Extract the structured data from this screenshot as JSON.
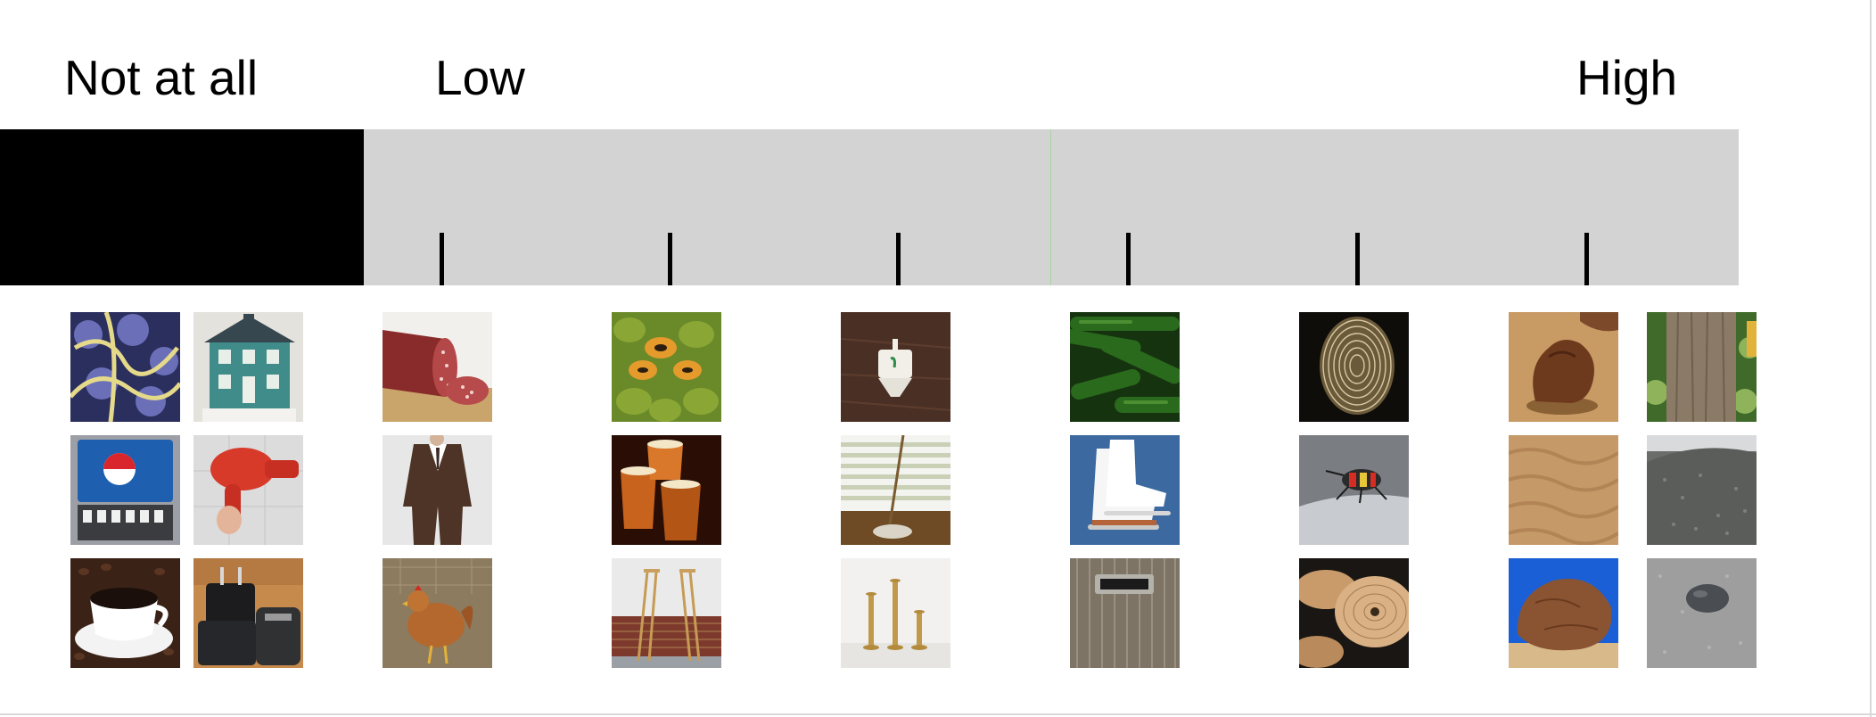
{
  "scale": {
    "label_not_at_all": "Not at all",
    "label_low": "Low",
    "label_high": "High",
    "tick_count": 6
  },
  "colors": {
    "not_at_all_block": "#000000",
    "slider_track": "#d3d3d3",
    "center_marker": "#a6d6a0",
    "tick": "#000000"
  },
  "images": [
    {
      "name": "image-flowers-blue-gold",
      "icon": "flowers"
    },
    {
      "name": "image-dollhouse",
      "icon": "dollhouse"
    },
    {
      "name": "image-soda-fountain",
      "icon": "soda-fountain"
    },
    {
      "name": "image-hair-dryer",
      "icon": "hair-dryer"
    },
    {
      "name": "image-coffee-cup",
      "icon": "coffee-cup"
    },
    {
      "name": "image-luggage",
      "icon": "luggage"
    },
    {
      "name": "image-salami",
      "icon": "salami"
    },
    {
      "name": "image-suit",
      "icon": "suit"
    },
    {
      "name": "image-chicken",
      "icon": "chicken"
    },
    {
      "name": "image-papayas",
      "icon": "papayas"
    },
    {
      "name": "image-beer-glasses",
      "icon": "beer-glasses"
    },
    {
      "name": "image-crutches",
      "icon": "crutches"
    },
    {
      "name": "image-dreidel",
      "icon": "dreidel"
    },
    {
      "name": "image-window-blinds",
      "icon": "window-blinds"
    },
    {
      "name": "image-candlesticks",
      "icon": "candlesticks"
    },
    {
      "name": "image-zucchini",
      "icon": "zucchini"
    },
    {
      "name": "image-ice-skates",
      "icon": "ice-skates"
    },
    {
      "name": "image-mail-slot",
      "icon": "mail-slot"
    },
    {
      "name": "image-fingerprint",
      "icon": "fingerprint"
    },
    {
      "name": "image-beetle",
      "icon": "beetle"
    },
    {
      "name": "image-cymbals",
      "icon": "cymbals"
    },
    {
      "name": "image-clay-lump",
      "icon": "clay"
    },
    {
      "name": "image-tree-trunk",
      "icon": "tree-trunk"
    },
    {
      "name": "image-sand",
      "icon": "sand"
    },
    {
      "name": "image-gravel",
      "icon": "gravel"
    },
    {
      "name": "image-boulder",
      "icon": "boulder"
    },
    {
      "name": "image-pebble",
      "icon": "pebble"
    }
  ]
}
